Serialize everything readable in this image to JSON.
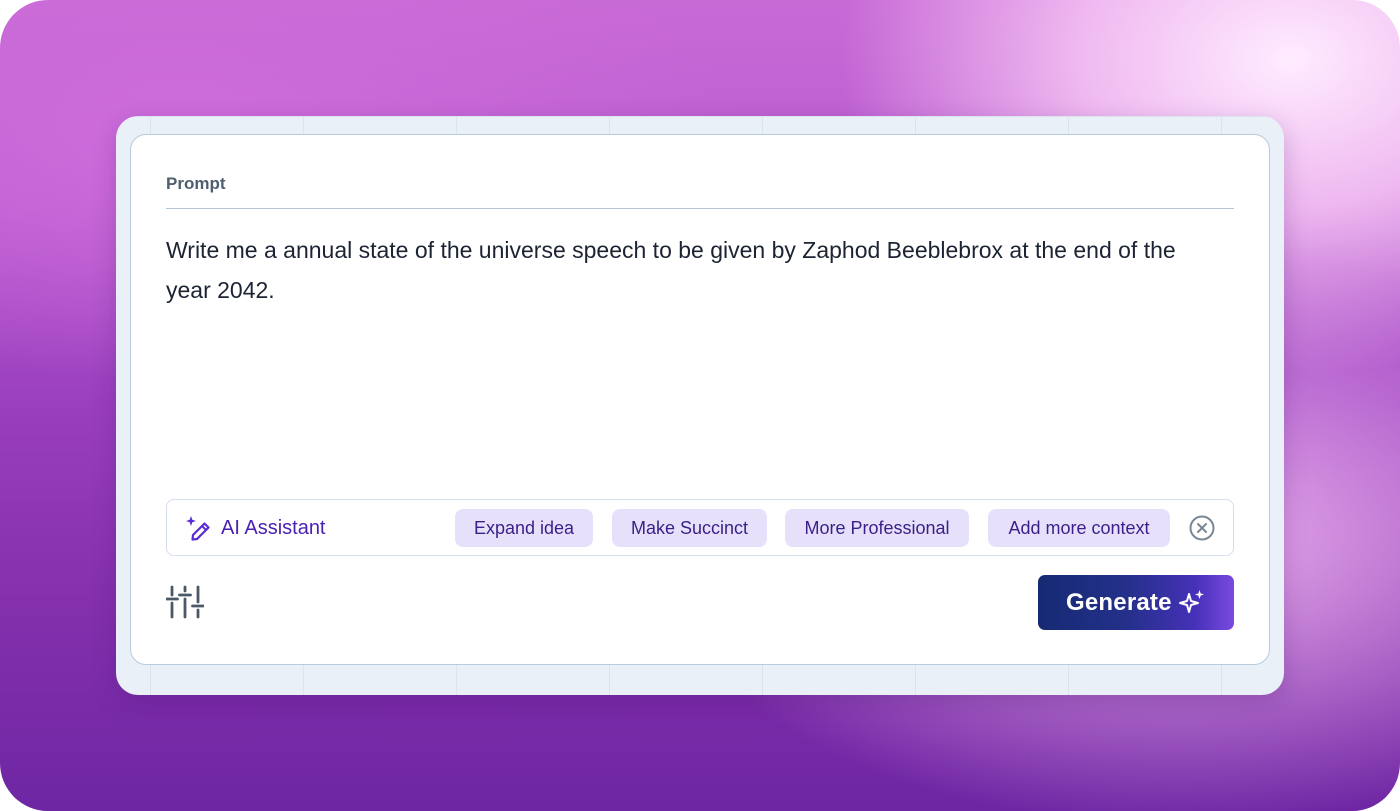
{
  "prompt": {
    "label": "Prompt",
    "text": "Write me a annual state of the universe speech to be given by Zaphod Beeblebrox at the end of the year 2042."
  },
  "assistant": {
    "icon": "magic-wand-sparkle-icon",
    "label": "AI Assistant",
    "chips": [
      "Expand idea",
      "Make Succinct",
      "More Professional",
      "Add more context"
    ],
    "close_icon": "close-circle-icon"
  },
  "toolbar": {
    "settings_icon": "sliders-icon",
    "generate_label": "Generate",
    "generate_icon": "sparkle-icon"
  },
  "colors": {
    "accent_purple": "#4a1fb3",
    "chip_background": "#e6e0fb",
    "generate_start": "#152a73",
    "generate_end": "#7b49e0"
  }
}
